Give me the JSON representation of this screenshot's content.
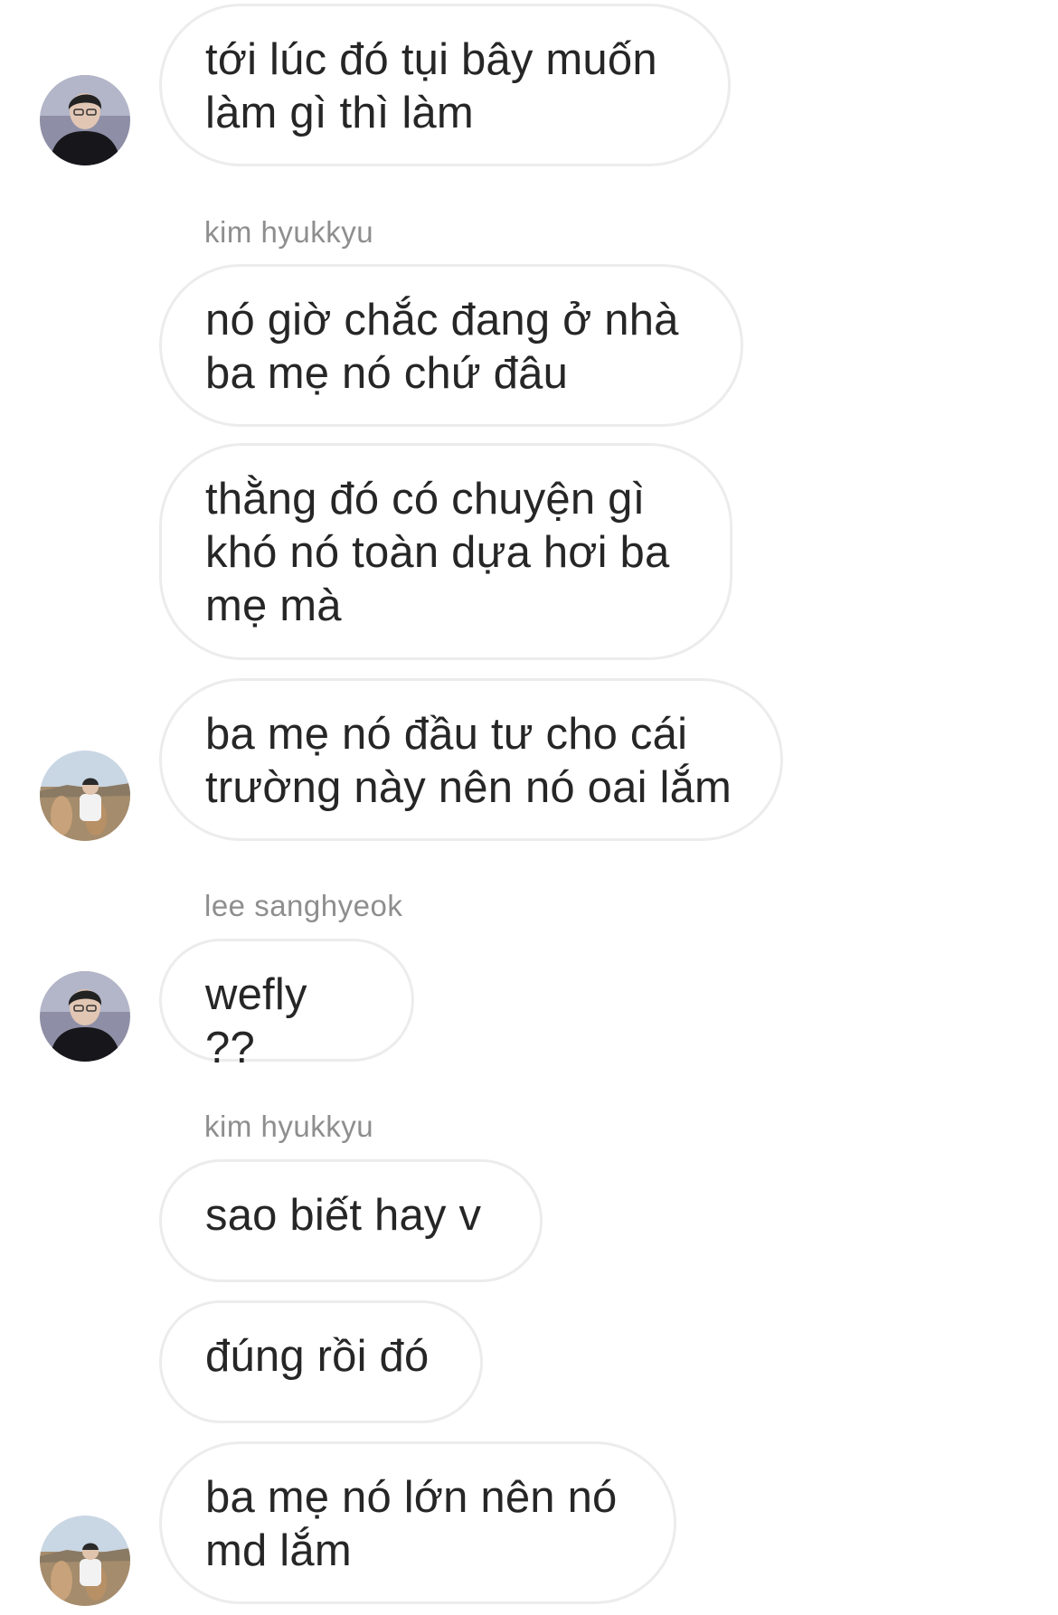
{
  "thread": {
    "messages": [
      {
        "text": "tới lúc đó tụi bây muốn\nlàm gì thì làm"
      },
      {
        "sender": "kim hyukkyu",
        "text": "nó giờ chắc đang ở nhà\nba mẹ nó chứ đâu"
      },
      {
        "text": "thằng đó có chuyện gì\nkhó nó toàn dựa hơi ba\nmẹ mà"
      },
      {
        "text": "ba mẹ nó đầu tư cho cái\ntrường này nên nó oai lắm"
      },
      {
        "sender": "lee sanghyeok",
        "text": "wefly ??"
      },
      {
        "sender": "kim hyukkyu",
        "text": "sao biết hay v"
      },
      {
        "text": "đúng rồi đó"
      },
      {
        "text": "ba mẹ nó lớn nên nó\nmd lắm"
      }
    ],
    "avatars": [
      {
        "user": "lee sanghyeok",
        "icon": "user-avatar-dark-icon"
      },
      {
        "user": "kim hyukkyu",
        "icon": "user-avatar-outdoor-icon"
      },
      {
        "user": "lee sanghyeok",
        "icon": "user-avatar-dark-icon"
      },
      {
        "user": "kim hyukkyu",
        "icon": "user-avatar-outdoor-icon"
      }
    ]
  },
  "colors": {
    "bubble_border": "#ececec",
    "text": "#262626",
    "sender_name": "#8e8e8e",
    "background": "#ffffff"
  }
}
